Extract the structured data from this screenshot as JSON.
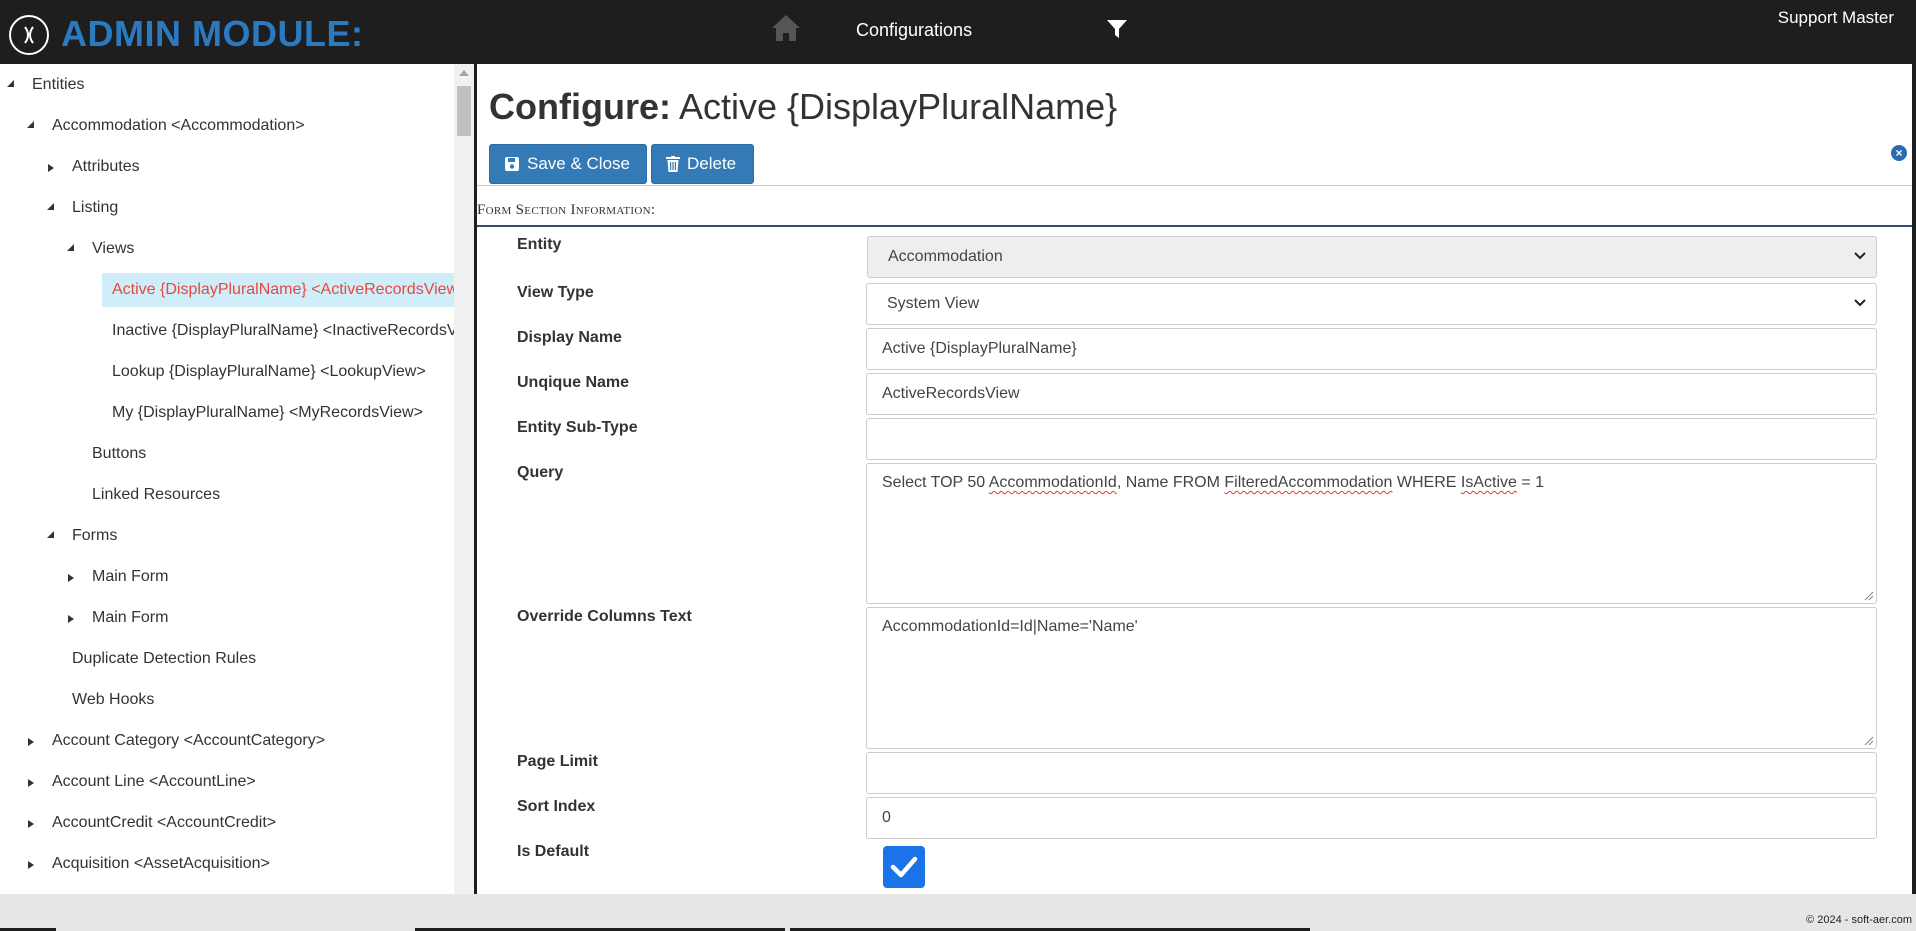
{
  "app": {
    "brand": "ADMIN MODULE:",
    "nav_configurations": "Configurations",
    "user": "Support Master"
  },
  "tree": {
    "items": [
      {
        "label": "Entities",
        "toggle": "expanded"
      },
      {
        "label": "Accommodation <Accommodation>",
        "toggle": "expanded"
      },
      {
        "label": "Attributes",
        "toggle": "collapsed"
      },
      {
        "label": "Listing",
        "toggle": "expanded"
      },
      {
        "label": "Views",
        "toggle": "expanded"
      },
      {
        "label": "Active {DisplayPluralName} <ActiveRecordsView>",
        "toggle": "none",
        "selected": true
      },
      {
        "label": "Inactive {DisplayPluralName} <InactiveRecordsView>",
        "toggle": "none"
      },
      {
        "label": "Lookup {DisplayPluralName} <LookupView>",
        "toggle": "none"
      },
      {
        "label": "My {DisplayPluralName} <MyRecordsView>",
        "toggle": "none"
      },
      {
        "label": "Buttons",
        "toggle": "none"
      },
      {
        "label": "Linked Resources",
        "toggle": "none"
      },
      {
        "label": "Forms",
        "toggle": "expanded"
      },
      {
        "label": "Main Form",
        "toggle": "collapsed"
      },
      {
        "label": "Main Form",
        "toggle": "collapsed"
      },
      {
        "label": "Duplicate Detection Rules",
        "toggle": "none"
      },
      {
        "label": "Web Hooks",
        "toggle": "none"
      },
      {
        "label": "Account Category <AccountCategory>",
        "toggle": "collapsed"
      },
      {
        "label": "Account Line <AccountLine>",
        "toggle": "collapsed"
      },
      {
        "label": "AccountCredit <AccountCredit>",
        "toggle": "collapsed"
      },
      {
        "label": "Acquisition <AssetAcquisition>",
        "toggle": "collapsed"
      }
    ]
  },
  "page": {
    "title_prefix": "Configure:",
    "title_name": "Active {DisplayPluralName}",
    "save_close_label": "Save & Close",
    "delete_label": "Delete",
    "section_title": "Form Section Information:"
  },
  "form": {
    "entity": {
      "label": "Entity",
      "value": "Accommodation"
    },
    "view_type": {
      "label": "View Type",
      "value": "System View"
    },
    "display_name": {
      "label": "Display Name",
      "value": "Active {DisplayPluralName}"
    },
    "unique_name": {
      "label": "Unqique Name",
      "value": "ActiveRecordsView"
    },
    "entity_sub_type": {
      "label": "Entity Sub-Type",
      "value": ""
    },
    "query": {
      "label": "Query",
      "parts": [
        "Select TOP 50 ",
        "AccommodationId",
        ", Name FROM ",
        "FilteredAccommodation",
        " WHERE ",
        "IsActive",
        " = 1"
      ]
    },
    "override_columns": {
      "label": "Override Columns Text",
      "value": "AccommodationId=Id|Name='Name'"
    },
    "page_limit": {
      "label": "Page Limit",
      "value": ""
    },
    "sort_index": {
      "label": "Sort Index",
      "value": "0"
    },
    "is_default": {
      "label": "Is Default",
      "checked": true
    }
  },
  "footer": {
    "copyright": "© 2024 - soft-aer.com"
  },
  "colors": {
    "topbar": "#1e1e1e",
    "brand": "#2b7ac0",
    "button": "#337ab7",
    "selected_bg": "#cfeefa",
    "selected_text": "#e8473e",
    "checkbox": "#1a73e8"
  }
}
